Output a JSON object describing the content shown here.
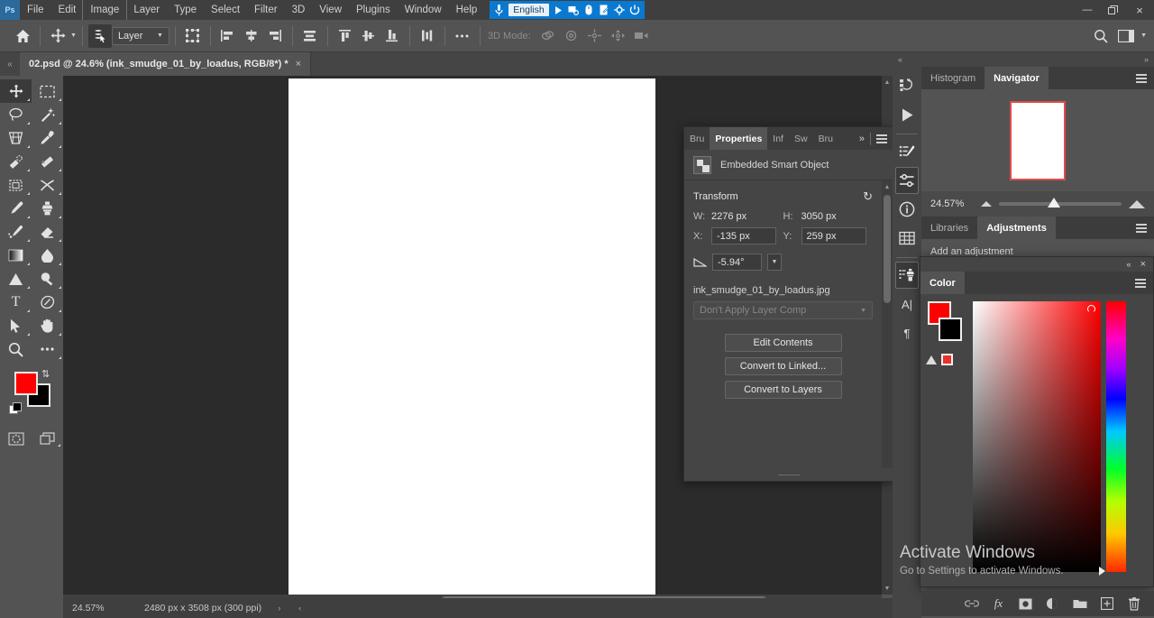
{
  "menubar": {
    "logo": "Ps",
    "items": [
      "File",
      "Edit",
      "Image",
      "Layer",
      "Type",
      "Select",
      "Filter",
      "3D",
      "View",
      "Plugins",
      "Window",
      "Help"
    ],
    "language_bar": {
      "mic_icon": "microphone-icon",
      "language": "English",
      "play_icon": "play-icon",
      "screen_icon": "screen-icon",
      "mouse_icon": "mouse-icon",
      "note_icon": "note-icon",
      "gear_icon": "gear-icon",
      "power_icon": "power-icon"
    },
    "window_controls": {
      "minimize": "—",
      "restore": "❐",
      "close": "×"
    }
  },
  "optionsbar": {
    "home_icon": "home-icon",
    "move_tool_icon": "move-tool-icon",
    "auto_select_icon": "auto-select-icon",
    "layer_select_value": "Layer",
    "transform_controls_icon": "transform-controls-icon",
    "align_left_icon": "align-left-icon",
    "align_center_h_icon": "align-center-horizontal-icon",
    "align_right_icon": "align-right-icon",
    "distribute_h_icon": "distribute-horizontal-icon",
    "align_top_icon": "align-top-icon",
    "align_middle_v_icon": "align-middle-vertical-icon",
    "align_bottom_icon": "align-bottom-icon",
    "distribute_v_icon": "distribute-vertical-icon",
    "more_icon": "ellipsis-icon",
    "mode3d_label": "3D Mode:",
    "mode3d_icons": [
      "rotate-3d-icon",
      "roll-3d-icon",
      "pan-3d-icon",
      "slide-3d-icon",
      "camera-3d-icon"
    ],
    "search_icon": "search-icon",
    "workspace_icon": "workspace-icon",
    "workspace_caret": "chevron-down-icon"
  },
  "tabbar": {
    "collapse_icon": "«",
    "expand_icon": "»",
    "document_title": "02.psd @ 24.6% (ink_smudge_01_by_loadus, RGB/8*) *",
    "close_tab": "×"
  },
  "toolbar": {
    "tools": [
      {
        "name": "move-tool",
        "glyph": "move",
        "selected": true
      },
      {
        "name": "rectangular-marquee-tool",
        "glyph": "marquee",
        "selected": false
      },
      {
        "name": "lasso-tool",
        "glyph": "lasso",
        "selected": false
      },
      {
        "name": "magic-wand-tool",
        "glyph": "wand",
        "selected": false
      },
      {
        "name": "crop-tool",
        "glyph": "crop",
        "selected": false
      },
      {
        "name": "eyedropper-tool",
        "glyph": "eyedropper",
        "selected": false
      },
      {
        "name": "spot-healing-brush-tool",
        "glyph": "heal",
        "selected": false
      },
      {
        "name": "patch-tool",
        "glyph": "patch",
        "selected": false
      },
      {
        "name": "frame-tool",
        "glyph": "frame",
        "selected": false
      },
      {
        "name": "clone-mix-tool",
        "glyph": "mix",
        "selected": false
      },
      {
        "name": "brush-tool",
        "glyph": "brush",
        "selected": false
      },
      {
        "name": "clone-stamp-tool",
        "glyph": "stamp",
        "selected": false
      },
      {
        "name": "history-brush-tool",
        "glyph": "historybrush",
        "selected": false
      },
      {
        "name": "eraser-tool",
        "glyph": "eraser",
        "selected": false
      },
      {
        "name": "gradient-tool",
        "glyph": "gradient",
        "selected": false
      },
      {
        "name": "blur-tool",
        "glyph": "blur",
        "selected": false
      },
      {
        "name": "dodge-tool",
        "glyph": "dodge",
        "selected": false
      },
      {
        "name": "burn-tool",
        "glyph": "burn",
        "selected": false
      },
      {
        "name": "type-tool",
        "glyph": "type",
        "selected": false
      },
      {
        "name": "pen-tool",
        "glyph": "pen",
        "selected": false
      },
      {
        "name": "path-selection-tool",
        "glyph": "arrow",
        "selected": false
      },
      {
        "name": "hand-tool",
        "glyph": "hand",
        "selected": false
      },
      {
        "name": "zoom-tool",
        "glyph": "zoom",
        "selected": false
      },
      {
        "name": "edit-toolbar",
        "glyph": "ellipsis",
        "selected": false
      }
    ],
    "foreground_color": "#fe0000",
    "background_color": "#000000",
    "swap_icon": "swap-colors-icon",
    "default_colors_icon": "default-colors-icon",
    "quick_mask_icon": "quick-mask-icon",
    "screen_mode_icon": "screen-mode-icon"
  },
  "properties": {
    "tabs": [
      {
        "label": "Bru",
        "active": false
      },
      {
        "label": "Properties",
        "active": true
      },
      {
        "label": "Inf",
        "active": false
      },
      {
        "label": "Sw",
        "active": false
      },
      {
        "label": "Bru",
        "active": false
      }
    ],
    "overflow_icon": "»",
    "menu_icon": "panel-menu-icon",
    "object_type": "Embedded Smart Object",
    "object_icon": "smart-object-icon",
    "transform": {
      "section_title": "Transform",
      "reset_icon": "reset-icon",
      "w_label": "W:",
      "w_value": "2276 px",
      "h_label": "H:",
      "h_value": "3050 px",
      "x_label": "X:",
      "x_value": "-135 px",
      "y_label": "Y:",
      "y_value": "259 px",
      "angle_icon": "angle-icon",
      "angle_value": "-5.94°",
      "angle_caret": "chevron-down-icon"
    },
    "filename": "ink_smudge_01_by_loadus.jpg",
    "layer_comp_placeholder": "Don't Apply Layer Comp",
    "layer_comp_caret": "chevron-down-icon",
    "buttons": [
      "Edit Contents",
      "Convert to Linked...",
      "Convert to Layers"
    ]
  },
  "dock": {
    "collapse_icon": "«",
    "expand_icon": "»",
    "rail_icons": [
      "history-icon",
      "actions-play-icon",
      "brush-settings-icon",
      "adjustments-icon",
      "info-icon",
      "swatches-grid-icon",
      "clone-source-icon",
      "character-icon",
      "paragraph-icon"
    ],
    "navigator_group": {
      "tabs": [
        {
          "label": "Histogram",
          "active": false
        },
        {
          "label": "Navigator",
          "active": true
        }
      ],
      "menu_icon": "panel-menu-icon",
      "zoom_value": "24.57%",
      "zoom_out_icon": "zoom-out-icon",
      "zoom_in_icon": "zoom-in-icon"
    },
    "adjustments_group": {
      "tabs": [
        {
          "label": "Libraries",
          "active": false
        },
        {
          "label": "Adjustments",
          "active": true
        }
      ],
      "menu_icon": "panel-menu-icon",
      "label": "Add an adjustment"
    }
  },
  "color_panel": {
    "collapse_icon": "«",
    "close_icon": "×",
    "tab_label": "Color",
    "menu_icon": "panel-menu-icon",
    "foreground_swatch": "#fe0000",
    "background_swatch": "#000000",
    "out_of_gamut_icon": "gamut-warning-icon",
    "gamut_swatch": "#e8322b"
  },
  "statusbar": {
    "zoom": "24.57%",
    "dimensions": "2480 px x 3508 px (300 ppi)",
    "arrow_right": "›",
    "arrow_left": "‹"
  },
  "watermark": {
    "title": "Activate Windows",
    "subtitle": "Go to Settings to activate Windows."
  },
  "layers_footer": {
    "icons": [
      "link-layers-icon",
      "fx-icon",
      "add-mask-icon",
      "adjustment-layer-icon",
      "new-group-icon",
      "new-layer-icon",
      "delete-layer-icon"
    ],
    "fx_label": "fx"
  }
}
